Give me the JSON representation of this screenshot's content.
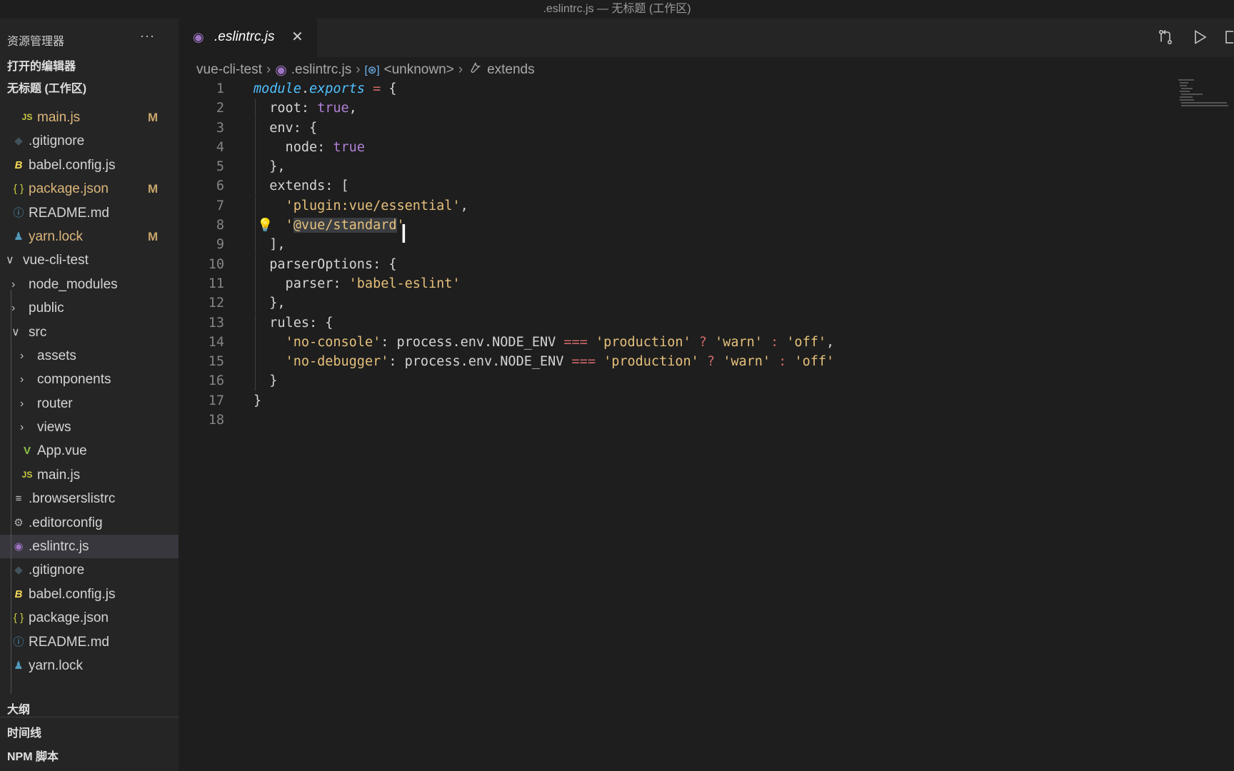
{
  "window": {
    "title": ".eslintrc.js — 无标题 (工作区)"
  },
  "sidebar": {
    "title": "资源管理器",
    "more": "···",
    "sections": {
      "open_editors": "打开的编辑器",
      "workspace": "无标题 (工作区)"
    },
    "tree": [
      {
        "label": "main.js",
        "icon": "js-file-icon",
        "glyph": "JS",
        "color": "#cbcb41",
        "indent": 1,
        "modified": "M"
      },
      {
        "label": ".gitignore",
        "icon": "git-file-icon",
        "glyph": "◆",
        "color": "#41535b",
        "indent": 0
      },
      {
        "label": "babel.config.js",
        "icon": "babel-file-icon",
        "glyph": "B",
        "color": "#f5da55",
        "indent": 0
      },
      {
        "label": "package.json",
        "icon": "json-file-icon",
        "glyph": "{ }",
        "color": "#cbcb41",
        "indent": 0,
        "modified": "M"
      },
      {
        "label": "README.md",
        "icon": "info-file-icon",
        "glyph": "ⓘ",
        "color": "#519aba",
        "indent": 0
      },
      {
        "label": "yarn.lock",
        "icon": "yarn-file-icon",
        "glyph": "♟",
        "color": "#519aba",
        "indent": 0,
        "modified": "M"
      },
      {
        "label": "vue-cli-test",
        "icon": "chevron-down-icon",
        "glyph": "∨",
        "folder": "open",
        "indent": -1
      },
      {
        "label": "node_modules",
        "icon": "chevron-right-icon",
        "glyph": "›",
        "folder": "closed",
        "indent": 0
      },
      {
        "label": "public",
        "icon": "chevron-right-icon",
        "glyph": "›",
        "folder": "closed",
        "indent": 0
      },
      {
        "label": "src",
        "icon": "chevron-down-icon",
        "glyph": "∨",
        "folder": "open",
        "indent": 0
      },
      {
        "label": "assets",
        "icon": "chevron-right-icon",
        "glyph": "›",
        "folder": "closed",
        "indent": 1
      },
      {
        "label": "components",
        "icon": "chevron-right-icon",
        "glyph": "›",
        "folder": "closed",
        "indent": 1
      },
      {
        "label": "router",
        "icon": "chevron-right-icon",
        "glyph": "›",
        "folder": "closed",
        "indent": 1
      },
      {
        "label": "views",
        "icon": "chevron-right-icon",
        "glyph": "›",
        "folder": "closed",
        "indent": 1
      },
      {
        "label": "App.vue",
        "icon": "vue-file-icon",
        "glyph": "V",
        "color": "#8dc149",
        "indent": 1
      },
      {
        "label": "main.js",
        "icon": "js-file-icon",
        "glyph": "JS",
        "color": "#cbcb41",
        "indent": 1
      },
      {
        "label": ".browserslistrc",
        "icon": "list-file-icon",
        "glyph": "≡",
        "color": "#c5c5c5",
        "indent": 0
      },
      {
        "label": ".editorconfig",
        "icon": "gear-icon",
        "glyph": "⚙",
        "color": "#b0b0b0",
        "indent": 0
      },
      {
        "label": ".eslintrc.js",
        "icon": "eslint-file-icon",
        "glyph": "◉",
        "color": "#a074c4",
        "indent": 0,
        "selected": true
      },
      {
        "label": ".gitignore",
        "icon": "git-file-icon",
        "glyph": "◆",
        "color": "#41535b",
        "indent": 0
      },
      {
        "label": "babel.config.js",
        "icon": "babel-file-icon",
        "glyph": "B",
        "color": "#f5da55",
        "indent": 0
      },
      {
        "label": "package.json",
        "icon": "json-file-icon",
        "glyph": "{ }",
        "color": "#cbcb41",
        "indent": 0
      },
      {
        "label": "README.md",
        "icon": "info-file-icon",
        "glyph": "ⓘ",
        "color": "#519aba",
        "indent": 0
      },
      {
        "label": "yarn.lock",
        "icon": "yarn-file-icon",
        "glyph": "♟",
        "color": "#519aba",
        "indent": 0
      }
    ],
    "panels": {
      "outline": "大纲",
      "timeline": "时间线",
      "npm": "NPM 脚本"
    }
  },
  "editor": {
    "tab": {
      "name": ".eslintrc.js",
      "close": "✕"
    },
    "breadcrumb": {
      "folder": "vue-cli-test",
      "file": ".eslintrc.js",
      "symbol": "<unknown>",
      "property": "extends",
      "separator": "›"
    },
    "lines": [
      [
        {
          "t": "module",
          "c": "kw-i"
        },
        {
          "t": "."
        },
        {
          "t": "exports",
          "c": "kw-i"
        },
        {
          "t": " "
        },
        {
          "t": "=",
          "c": "op"
        },
        {
          "t": " {"
        }
      ],
      [
        {
          "t": "  root: "
        },
        {
          "t": "true",
          "c": "bool"
        },
        {
          "t": ","
        }
      ],
      [
        {
          "t": "  env: {"
        }
      ],
      [
        {
          "t": "    node: "
        },
        {
          "t": "true",
          "c": "bool"
        }
      ],
      [
        {
          "t": "  },"
        }
      ],
      [
        {
          "t": "  extends: ["
        }
      ],
      [
        {
          "t": "    "
        },
        {
          "t": "'plugin:vue/essential'",
          "c": "str"
        },
        {
          "t": ","
        }
      ],
      [
        {
          "t": "    "
        },
        {
          "t": "'",
          "c": "str"
        },
        {
          "t": "@vue/standard",
          "c": "str hl"
        },
        {
          "t": "'",
          "c": "str"
        }
      ],
      [
        {
          "t": "  ],"
        }
      ],
      [
        {
          "t": "  parserOptions: {"
        }
      ],
      [
        {
          "t": "    parser: "
        },
        {
          "t": "'babel-eslint'",
          "c": "str"
        }
      ],
      [
        {
          "t": "  },"
        }
      ],
      [
        {
          "t": "  rules: {"
        }
      ],
      [
        {
          "t": "    "
        },
        {
          "t": "'no-console'",
          "c": "str"
        },
        {
          "t": ": process.env.NODE_ENV "
        },
        {
          "t": "===",
          "c": "op"
        },
        {
          "t": " "
        },
        {
          "t": "'production'",
          "c": "str"
        },
        {
          "t": " "
        },
        {
          "t": "?",
          "c": "op"
        },
        {
          "t": " "
        },
        {
          "t": "'warn'",
          "c": "str"
        },
        {
          "t": " "
        },
        {
          "t": ":",
          "c": "op"
        },
        {
          "t": " "
        },
        {
          "t": "'off'",
          "c": "str"
        },
        {
          "t": ","
        }
      ],
      [
        {
          "t": "    "
        },
        {
          "t": "'no-debugger'",
          "c": "str"
        },
        {
          "t": ": process.env.NODE_ENV "
        },
        {
          "t": "===",
          "c": "op"
        },
        {
          "t": " "
        },
        {
          "t": "'production'",
          "c": "str"
        },
        {
          "t": " "
        },
        {
          "t": "?",
          "c": "op"
        },
        {
          "t": " "
        },
        {
          "t": "'warn'",
          "c": "str"
        },
        {
          "t": " "
        },
        {
          "t": ":",
          "c": "op"
        },
        {
          "t": " "
        },
        {
          "t": "'off'",
          "c": "str"
        }
      ],
      [
        {
          "t": "  }"
        }
      ],
      [
        {
          "t": "}"
        }
      ],
      []
    ],
    "lightbulb_line": 8
  },
  "colors": {
    "accent": "#a074c4",
    "modified": "#dcb67a",
    "selection": "#37373d"
  }
}
